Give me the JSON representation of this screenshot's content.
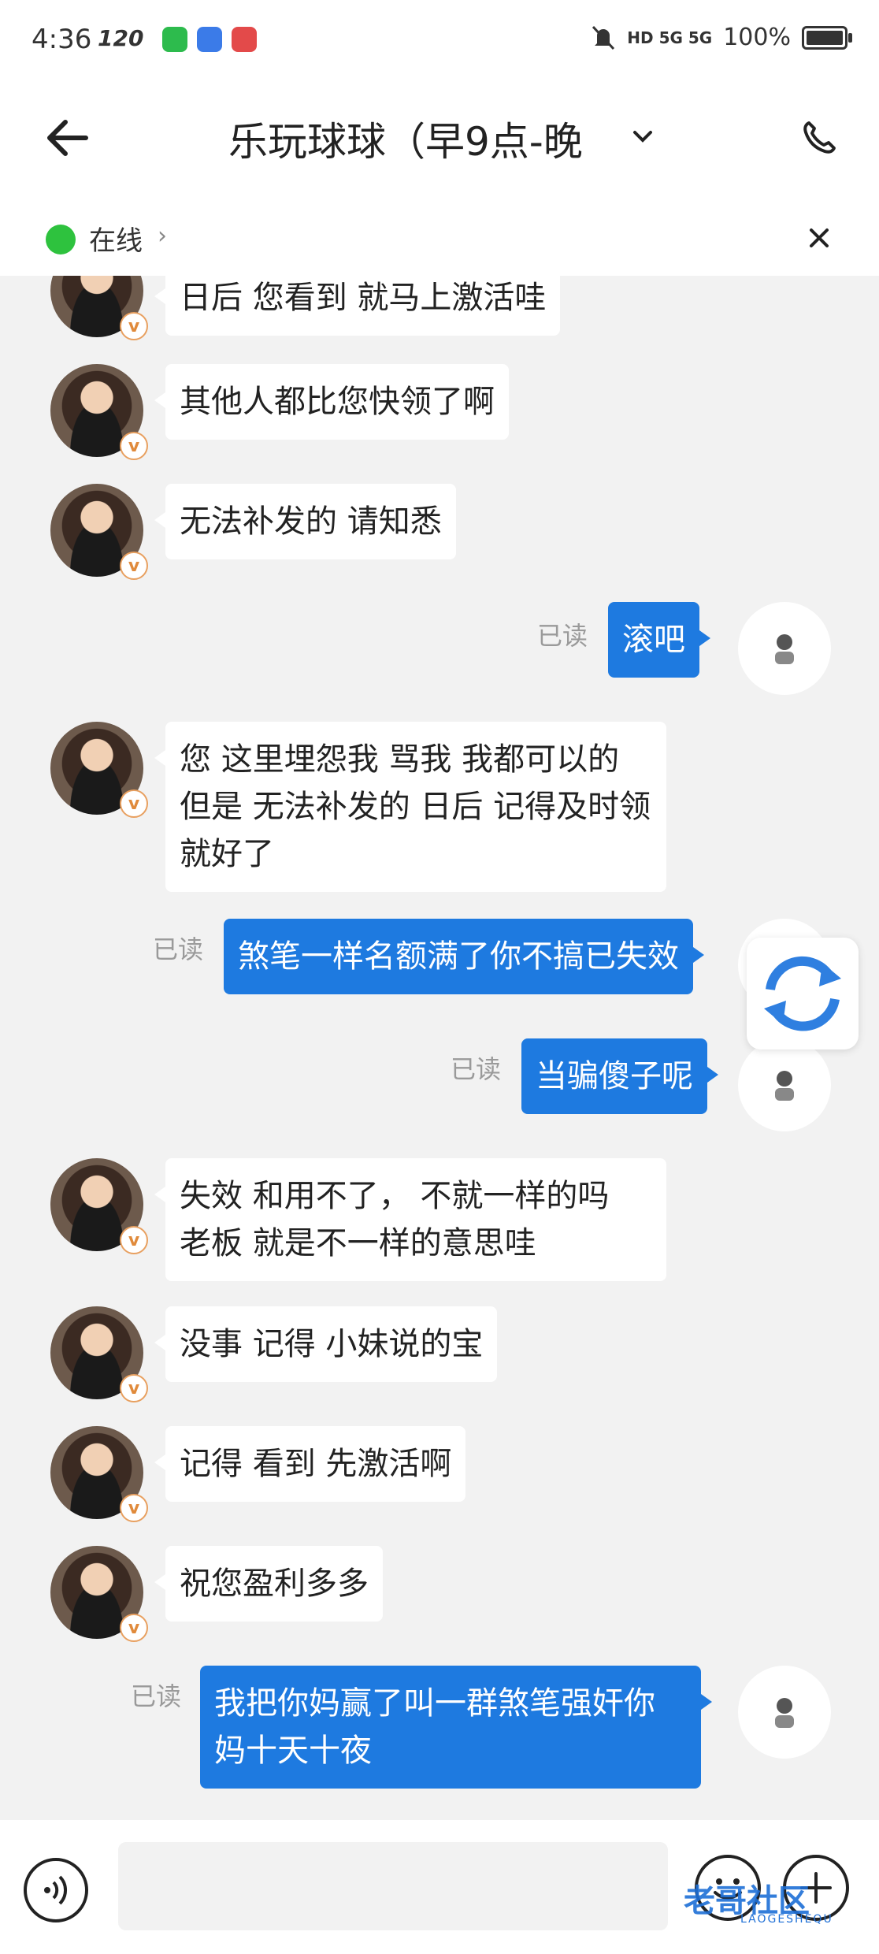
{
  "status_bar": {
    "time": "4:36",
    "refresh_rate": "120",
    "network": "HD 5G 5G",
    "battery": "100%"
  },
  "header": {
    "title": "乐玩球球（早9点-晚",
    "online_status": "在线",
    "online_chevron": "›"
  },
  "messages": [
    {
      "side": "left",
      "text": "日后 您看到 就马上激活哇"
    },
    {
      "side": "left",
      "text": "其他人都比您快领了啊"
    },
    {
      "side": "left",
      "text": "无法补发的 请知悉"
    },
    {
      "side": "right",
      "text": "滚吧",
      "read": "已读"
    },
    {
      "side": "left",
      "text": "您 这里埋怨我 骂我 我都可以的\n但是 无法补发的 日后 记得及时领\n就好了"
    },
    {
      "side": "right",
      "text": "煞笔一样名额满了你不搞已失效",
      "read": "已读"
    },
    {
      "side": "right",
      "text": "当骗傻子呢",
      "read": "已读"
    },
    {
      "side": "left",
      "text": "失效  和用不了，  不就一样的吗\n老板 就是不一样的意思哇"
    },
    {
      "side": "left",
      "text": "没事 记得 小妹说的宝"
    },
    {
      "side": "left",
      "text": "记得 看到 先激活啊"
    },
    {
      "side": "left",
      "text": "祝您盈利多多"
    },
    {
      "side": "right",
      "text": "我把你妈赢了叫一群煞笔强奸你\n妈十天十夜",
      "read": "已读"
    }
  ],
  "badge_letter": "v",
  "watermark": {
    "main": "老哥社区",
    "sub": "LAOGESHEQU"
  },
  "colors": {
    "accent": "#1e7ae0",
    "online": "#2ec23e",
    "chat_bg": "#f2f2f2"
  }
}
